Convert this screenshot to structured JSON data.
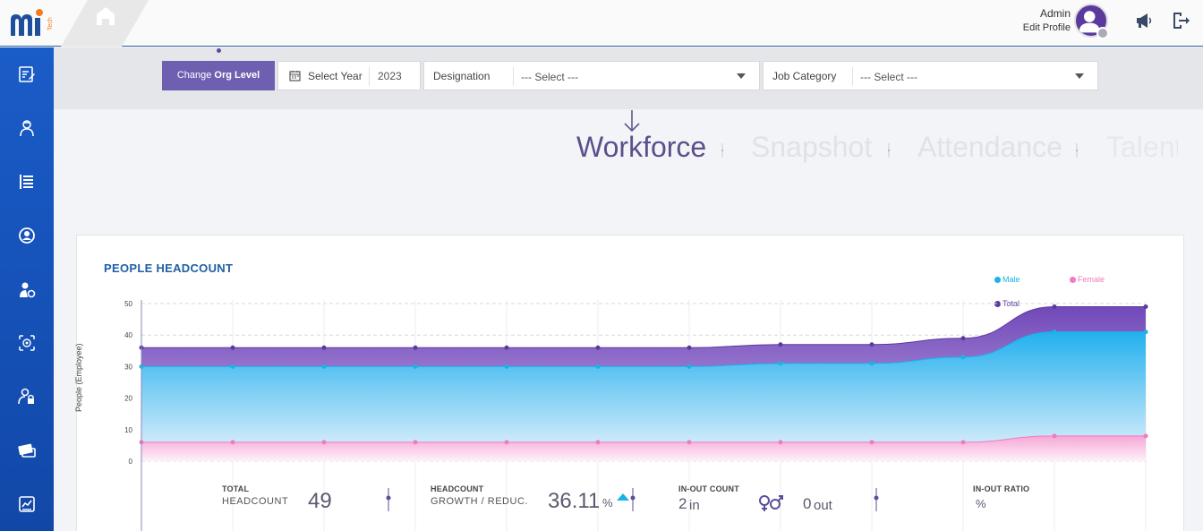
{
  "header": {
    "admin_name": "Admin",
    "edit_profile": "Edit Profile",
    "icons": [
      "home-icon",
      "megaphone-icon",
      "logout-icon"
    ],
    "accent": "#2f5f9c"
  },
  "sidebar": {
    "items": [
      {
        "icon": "form-edit-icon"
      },
      {
        "icon": "employee-icon"
      },
      {
        "icon": "list-icon"
      },
      {
        "icon": "user-circle-icon"
      },
      {
        "icon": "user-settings-icon"
      },
      {
        "icon": "fingerprint-icon"
      },
      {
        "icon": "user-lock-icon"
      },
      {
        "icon": "payment-card-icon"
      },
      {
        "icon": "reports-icon"
      }
    ],
    "color": "#1a5cc8"
  },
  "filters": {
    "change_org_prefix": "Change ",
    "change_org_bold": "Org Level",
    "select_year_label": "Select Year",
    "select_year_value": "2023",
    "designation_label": "Designation",
    "designation_value": "--- Select ---",
    "job_category_label": "Job Category",
    "job_category_value": "--- Select ---"
  },
  "tabs": [
    {
      "label": "Workforce",
      "active": true
    },
    {
      "label": "Snapshot",
      "active": false
    },
    {
      "label": "Attendance",
      "active": false
    },
    {
      "label": "Talent",
      "active": false
    }
  ],
  "card": {
    "title": "PEOPLE HEADCOUNT",
    "stats": {
      "total_cap1": "TOTAL",
      "total_cap2": "HEADCOUNT",
      "total_value": "49",
      "growth_cap1": "HEADCOUNT",
      "growth_cap2": "GROWTH / REDUC.",
      "growth_value": "36.11",
      "growth_unit": "%",
      "inout_cap": "IN-OUT COUNT",
      "in_value": "2",
      "in_unit": "in",
      "out_value": "0",
      "out_unit": "out",
      "ratio_cap": "IN-OUT RATIO",
      "ratio_value": "%"
    }
  },
  "chart_data": {
    "type": "area",
    "ylabel": "People (Employee)",
    "ylim": [
      0,
      50
    ],
    "yticks": [
      0,
      10,
      20,
      30,
      40,
      50
    ],
    "x": [
      1,
      2,
      3,
      4,
      5,
      6,
      7,
      8,
      9,
      10,
      11,
      12
    ],
    "series": [
      {
        "name": "Male",
        "color": "#1ab3e6",
        "values": [
          30,
          30,
          30,
          30,
          30,
          30,
          30,
          31,
          31,
          33,
          41,
          41
        ]
      },
      {
        "name": "Female",
        "color": "#f07cbf",
        "values": [
          6,
          6,
          6,
          6,
          6,
          6,
          6,
          6,
          6,
          6,
          8,
          8
        ]
      },
      {
        "name": "Total",
        "color": "#5b3a9e",
        "values": [
          36,
          36,
          36,
          36,
          36,
          36,
          36,
          37,
          37,
          39,
          49,
          49
        ]
      }
    ],
    "grid": true,
    "legend_position": "top-right"
  }
}
